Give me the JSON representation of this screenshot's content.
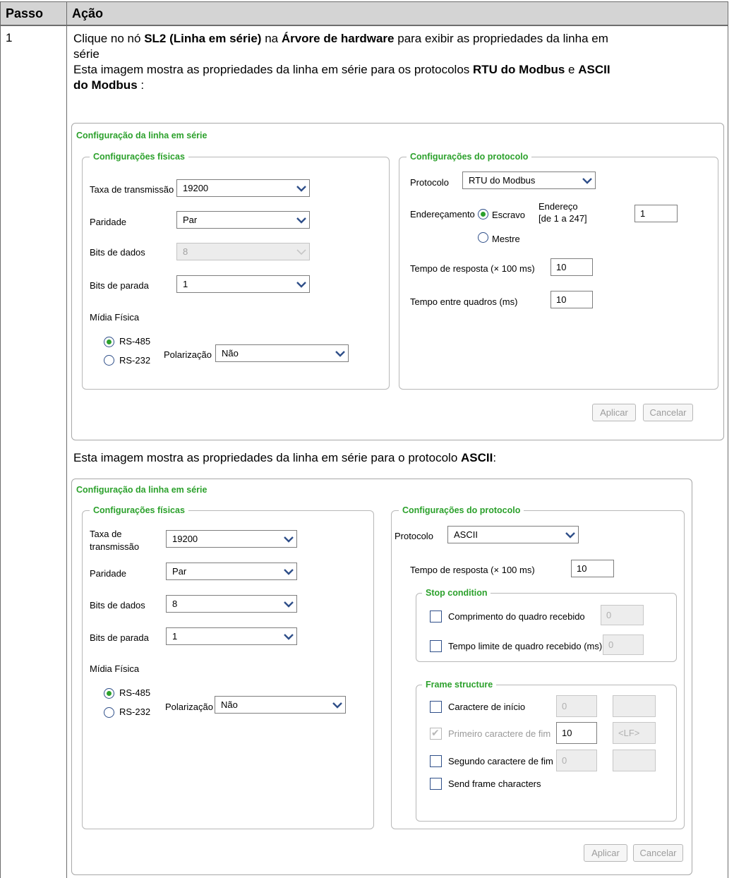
{
  "table": {
    "header_step": "Passo",
    "header_action": "Ação",
    "step_number": "1"
  },
  "paragraphs": {
    "p1": {
      "a": "Clique no nó ",
      "b": "SL2 (Linha em série)",
      "c": " na ",
      "d": "Árvore de hardware",
      "e": " para exibir as propriedades da linha em",
      "f": "série"
    },
    "p2": {
      "a": "Esta imagem mostra as propriedades da linha em série para os protocolos ",
      "b": "RTU do Modbus",
      "c": " e ",
      "d": "ASCII",
      "e": "do Modbus",
      "f": " :"
    },
    "p3": {
      "a": "Esta imagem mostra as propriedades da linha em série para o protocolo ",
      "b": "ASCII",
      "c": ":"
    }
  },
  "dialog1": {
    "title": "Configuração da linha em série",
    "physical": {
      "title": "Configurações físicas",
      "baud_label": "Taxa de transmissão",
      "baud_value": "19200",
      "parity_label": "Paridade",
      "parity_value": "Par",
      "databits_label": "Bits de dados",
      "databits_value": "8",
      "stopbits_label": "Bits de parada",
      "stopbits_value": "1",
      "media_label": "Mídia Física",
      "rs485": "RS-485",
      "rs232": "RS-232",
      "polar_label": "Polarização",
      "polar_value": "Não"
    },
    "protocol": {
      "title": "Configurações do protocolo",
      "protocol_label": "Protocolo",
      "protocol_value": "RTU do Modbus",
      "addressing_label": "Endereçamento",
      "slave": "Escravo",
      "master": "Mestre",
      "address_label_1": "Endereço",
      "address_label_2": "[de 1 a 247]",
      "address_value": "1",
      "response_label": "Tempo de resposta (× 100 ms)",
      "response_value": "10",
      "interframe_label": "Tempo entre quadros (ms)",
      "interframe_value": "10"
    },
    "apply": "Aplicar",
    "cancel": "Cancelar"
  },
  "dialog2": {
    "title": "Configuração da linha em série",
    "physical": {
      "title": "Configurações físicas",
      "baud_label_1": "Taxa de",
      "baud_label_2": "transmissão",
      "baud_value": "19200",
      "parity_label": "Paridade",
      "parity_value": "Par",
      "databits_label": "Bits de dados",
      "databits_value": "8",
      "stopbits_label": "Bits de parada",
      "stopbits_value": "1",
      "media_label": "Mídia Física",
      "rs485": "RS-485",
      "rs232": "RS-232",
      "polar_label": "Polarização",
      "polar_value": "Não"
    },
    "protocol": {
      "title": "Configurações do protocolo",
      "protocol_label": "Protocolo",
      "protocol_value": "ASCII",
      "response_label": "Tempo de resposta (× 100 ms)",
      "response_value": "10",
      "stop": {
        "title": "Stop condition",
        "received_length_label": "Comprimento do quadro recebido",
        "received_length_value": "0",
        "timeout_label": "Tempo limite de quadro recebido (ms)",
        "timeout_value": "0"
      },
      "frame": {
        "title": "Frame structure",
        "start_label": "Caractere de início",
        "start_value": "0",
        "first_end_label": "Primeiro caractere de fim",
        "first_end_value": "10",
        "first_end_char": "<LF>",
        "second_end_label": "Segundo caractere de fim",
        "second_end_value": "0",
        "send_label": "Send frame characters"
      }
    },
    "apply": "Aplicar",
    "cancel": "Cancelar"
  }
}
